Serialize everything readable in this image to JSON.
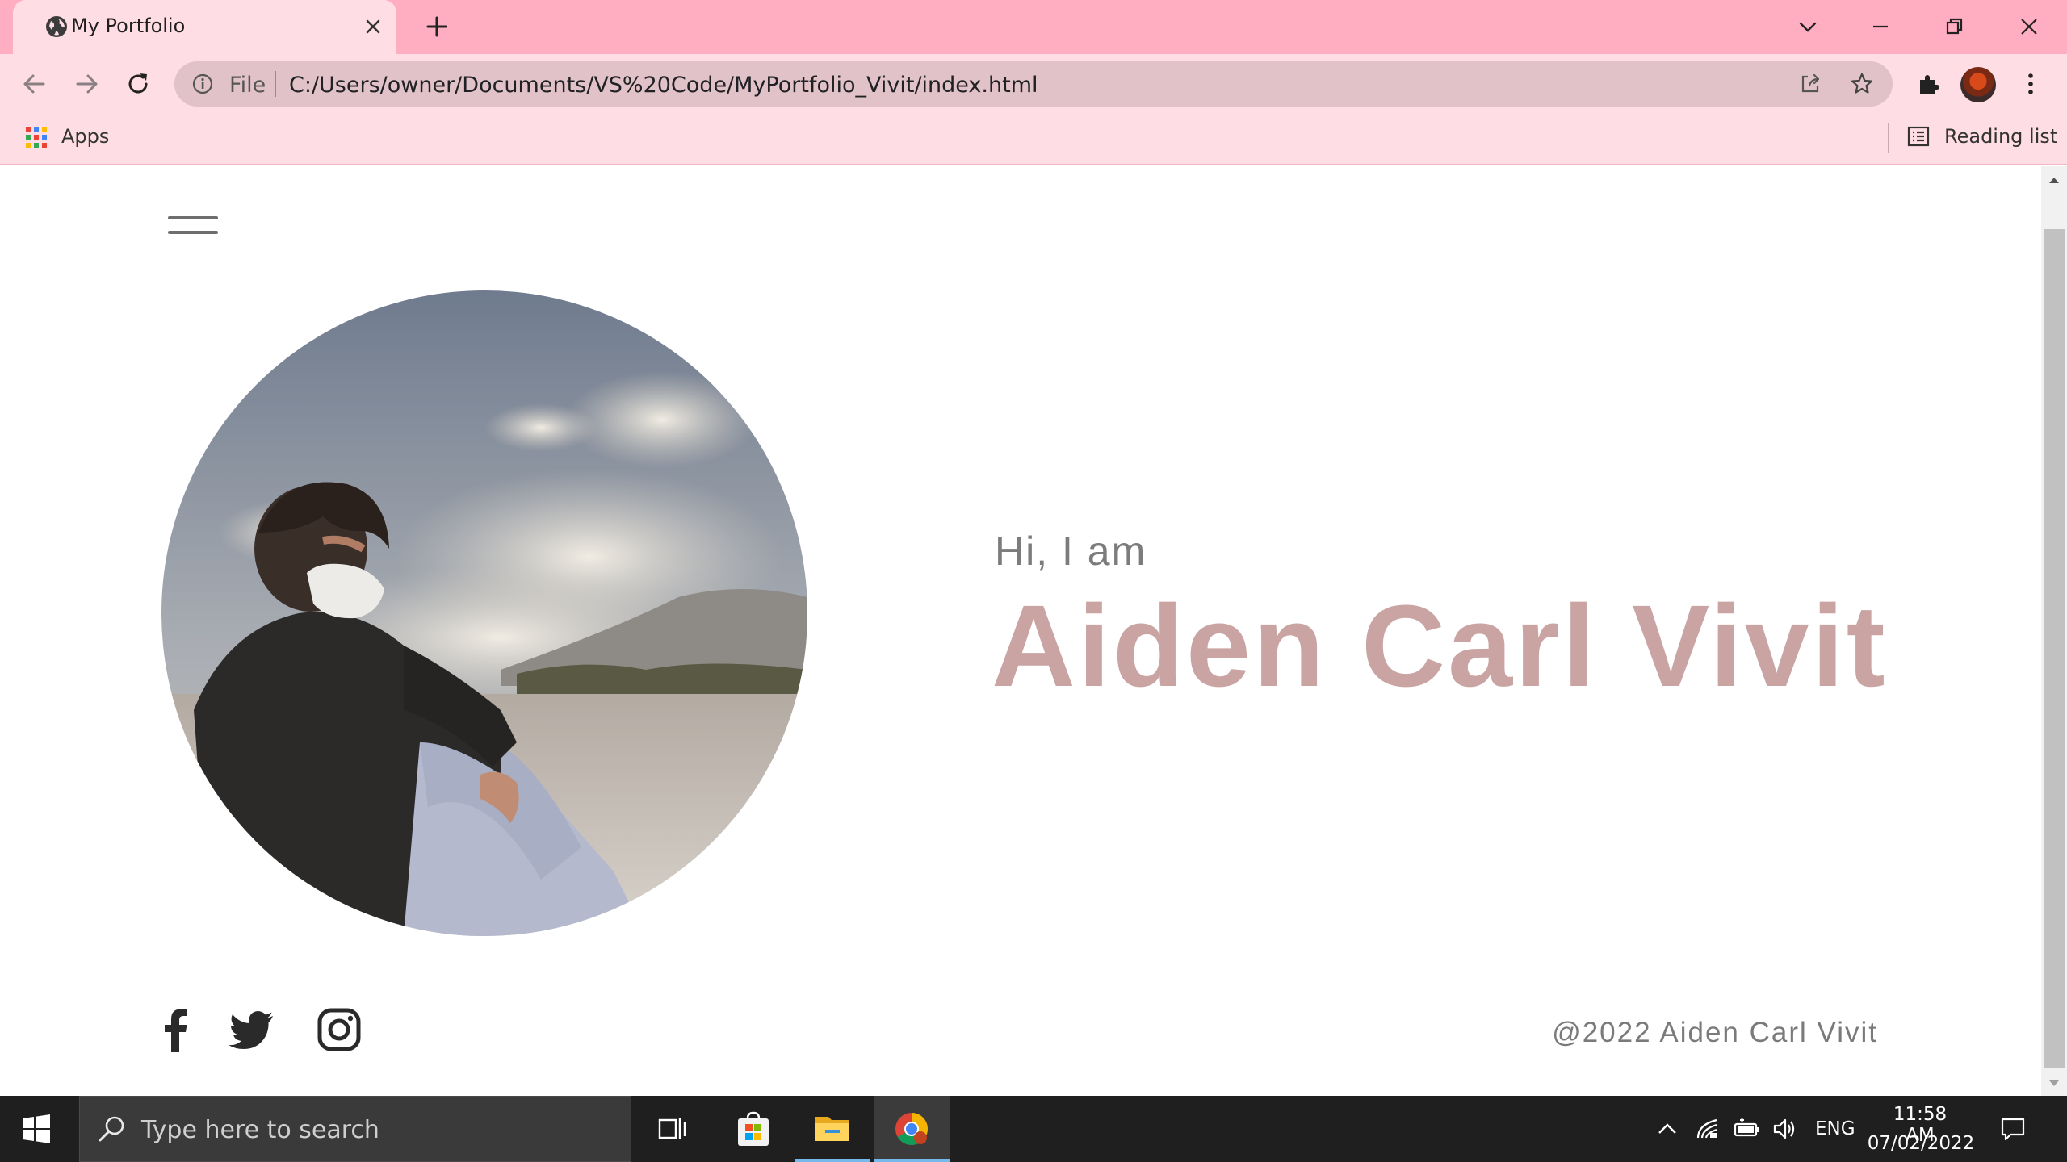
{
  "browser": {
    "tab": {
      "title": "My Portfolio"
    },
    "address": {
      "scheme_label": "File",
      "url": "C:/Users/owner/Documents/VS%20Code/MyPortfolio_Vivit/index.html"
    },
    "bookmarks": {
      "apps_label": "Apps",
      "reading_list_label": "Reading list"
    },
    "colors": {
      "tabbar": "#ffadc0",
      "toolbar": "#ffdde4",
      "omnibox": "#e2c2c9"
    }
  },
  "page": {
    "greeting": "Hi, I am",
    "name": "Aiden Carl Vivit",
    "copyright": "@2022 Aiden Carl Vivit",
    "social_icons": [
      "facebook-icon",
      "twitter-icon",
      "instagram-icon"
    ],
    "colors": {
      "name": "#c9a4a3",
      "greeting": "#7c7c7c",
      "copyright": "#7a7a7a"
    }
  },
  "taskbar": {
    "search_placeholder": "Type here to search",
    "language": "ENG",
    "time": "11:58 AM",
    "date": "07/02/2022"
  }
}
